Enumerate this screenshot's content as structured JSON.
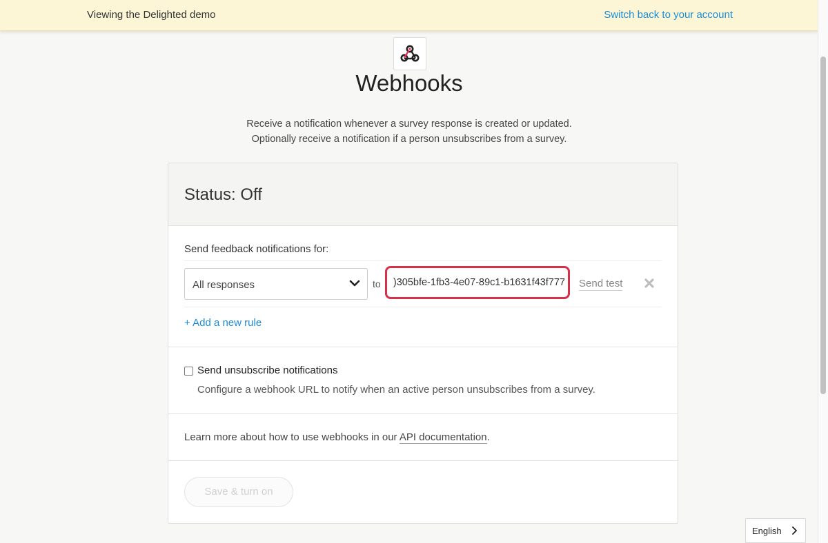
{
  "banner": {
    "text": "Viewing the Delighted demo",
    "switch_link": "Switch back to your account"
  },
  "header": {
    "logo_icon": "webhook-icon",
    "title": "Webhooks",
    "description_line1": "Receive a notification whenever a survey response is created or updated.",
    "description_line2": "Optionally receive a notification if a person unsubscribes from a survey."
  },
  "card": {
    "status_title": "Status: Off",
    "feedback_section_label": "Send feedback notifications for:",
    "rule": {
      "select_value": "All responses",
      "to_label": "to",
      "url_value": ")305bfe-1fb3-4e07-89c1-b1631f43f777",
      "send_test_label": "Send test",
      "remove_icon": "close-x-icon"
    },
    "add_rule_label": "+ Add a new rule",
    "unsubscribe": {
      "label": "Send unsubscribe notifications",
      "description": "Configure a webhook URL to notify when an active person unsubscribes from a survey.",
      "checked": false
    },
    "learn_more_prefix": "Learn more about how to use webhooks in our ",
    "learn_more_link": "API documentation",
    "learn_more_suffix": ".",
    "save_button": "Save & turn on"
  },
  "language": {
    "selected": "English"
  },
  "colors": {
    "banner_bg": "#fcf6d7",
    "link": "#1a8bd6",
    "highlight_border": "#d6314a",
    "page_bg": "#f7f7f6"
  }
}
